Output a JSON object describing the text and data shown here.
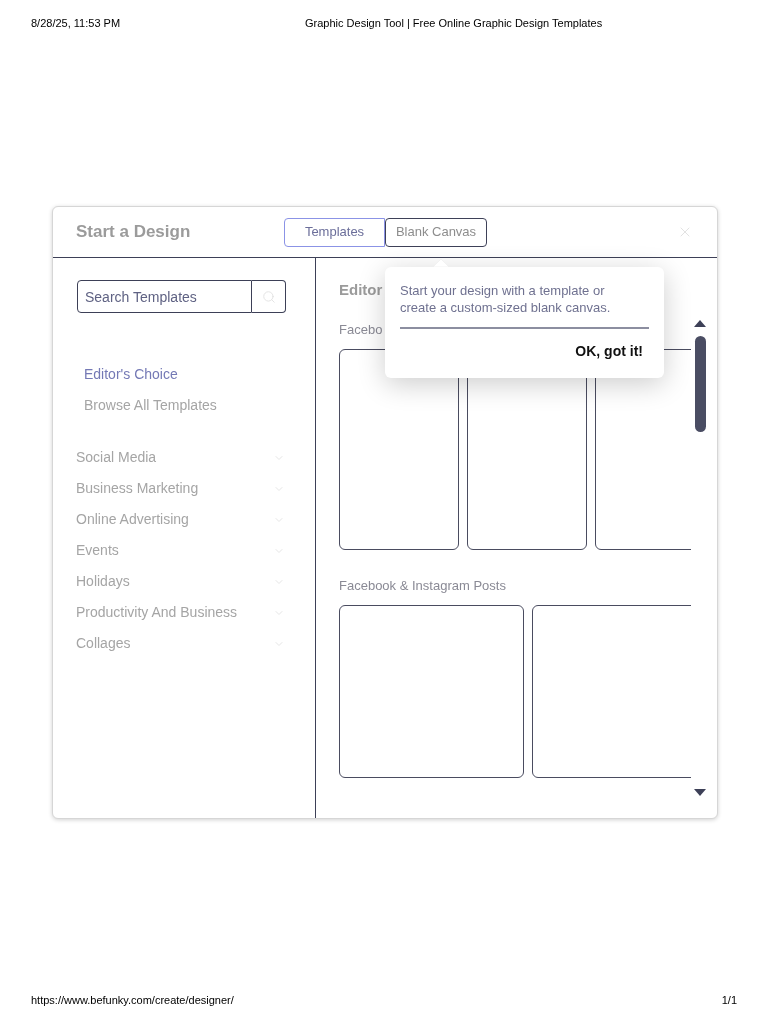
{
  "print_header": {
    "date": "8/28/25, 11:53 PM",
    "title": "Graphic Design Tool | Free Online Graphic Design Templates"
  },
  "dialog": {
    "title": "Start a Design",
    "tabs": [
      {
        "label": "Templates",
        "selected": true
      },
      {
        "label": "Blank Canvas",
        "selected": false
      }
    ],
    "search": {
      "placeholder": "Search Templates"
    },
    "sidebar": {
      "links": [
        {
          "label": "Editor's Choice",
          "selected": true
        },
        {
          "label": "Browse All Templates",
          "selected": false
        }
      ],
      "categories": [
        {
          "label": "Social Media",
          "expanded": false
        },
        {
          "label": "Business Marketing",
          "expanded": false
        },
        {
          "label": "Online Advertising",
          "expanded": false
        },
        {
          "label": "Events",
          "expanded": false
        },
        {
          "label": "Holidays",
          "expanded": false
        },
        {
          "label": "Productivity And Business",
          "expanded": false
        },
        {
          "label": "Collages",
          "expanded": false
        }
      ]
    },
    "content": {
      "heading": "Editor",
      "sections": [
        {
          "title": "Facebo",
          "cards": [
            {
              "kind": "portrait"
            },
            {
              "kind": "portrait"
            },
            {
              "kind": "portrait"
            }
          ]
        },
        {
          "title": "Facebook & Instagram Posts",
          "cards": [
            {
              "kind": "square"
            },
            {
              "kind": "square"
            }
          ]
        }
      ]
    },
    "popover": {
      "message": "Start your design with a template or create a custom-sized blank canvas.",
      "button": "OK, got it!"
    }
  },
  "print_footer": {
    "url": "https://www.befunky.com/create/designer/",
    "page": "1/1"
  }
}
